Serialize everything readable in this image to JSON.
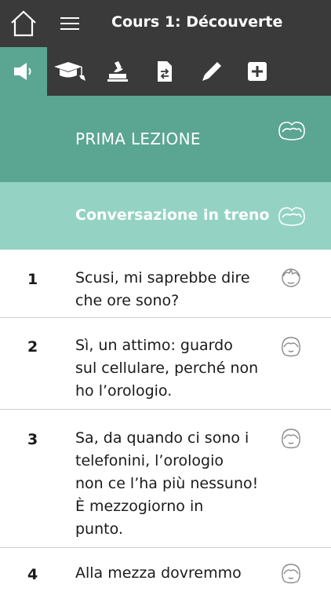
{
  "header": {
    "title": "Cours 1: Découverte"
  },
  "toolbar": {
    "items": [
      {
        "name": "listen",
        "icon": "speaker-icon",
        "active": true
      },
      {
        "name": "learn",
        "icon": "graduation-cap-icon",
        "active": false
      },
      {
        "name": "practice",
        "icon": "ink-stamp-icon",
        "active": false
      },
      {
        "name": "translate",
        "icon": "document-swap-icon",
        "active": false
      },
      {
        "name": "write",
        "icon": "pencil-icon",
        "active": false
      },
      {
        "name": "extra",
        "icon": "plus-box-icon",
        "active": false
      }
    ]
  },
  "lesson": {
    "title": "PRIMA LEZIONE"
  },
  "dialog": {
    "title": "Conversazione in treno"
  },
  "lines": [
    {
      "number": "1",
      "text": "Scusi, mi saprebbe dire\nche ore sono?",
      "speaker": "man"
    },
    {
      "number": "2",
      "text": "Sì, un attimo: guardo\nsul cellulare, perché non\nho l’orologio.",
      "speaker": "woman"
    },
    {
      "number": "3",
      "text": "Sa, da quando ci sono i\ntelefonini, l’orologio\nnon ce l’ha più nessuno!\nÈ mezzogiorno in\npunto.",
      "speaker": "woman"
    },
    {
      "number": "4",
      "text": "Alla mezza dovremmo",
      "speaker": "woman"
    }
  ],
  "colors": {
    "bar": "#3a3a3a",
    "accent": "#5ba593",
    "accent_light": "#94d3c4"
  }
}
